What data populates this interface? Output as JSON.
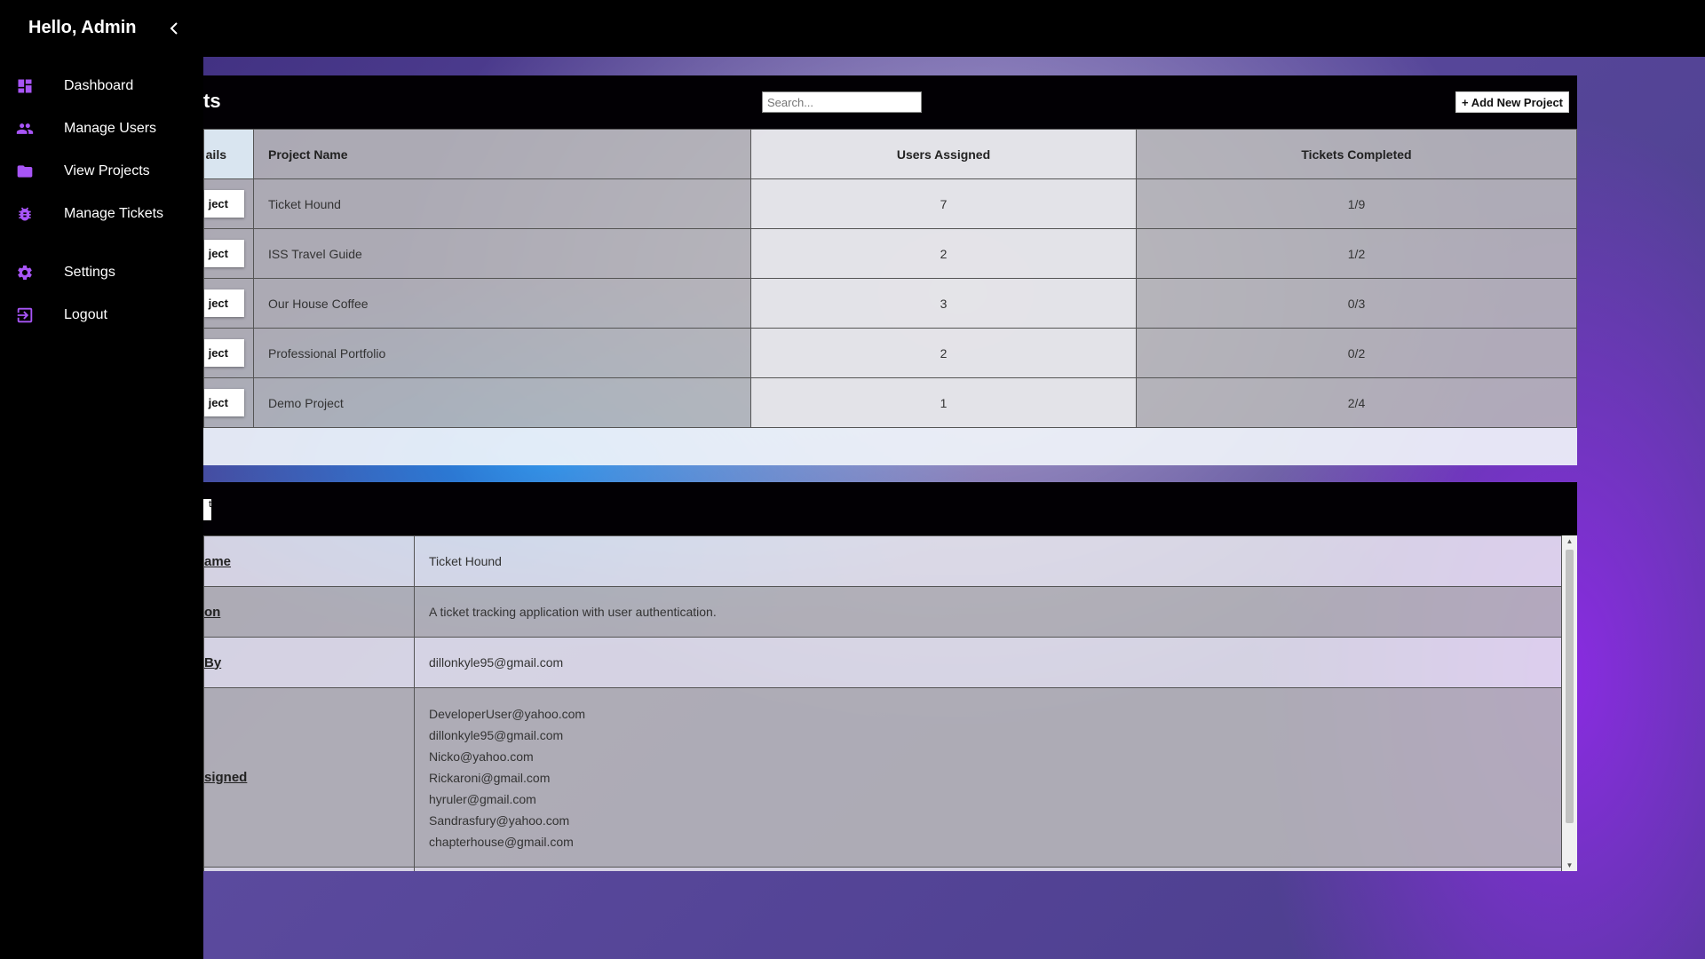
{
  "sidebar": {
    "greeting": "Hello, Admin",
    "items": [
      {
        "label": "Dashboard",
        "icon": "dashboard-icon"
      },
      {
        "label": "Manage Users",
        "icon": "users-icon"
      },
      {
        "label": "View Projects",
        "icon": "folder-icon"
      },
      {
        "label": "Manage Tickets",
        "icon": "bug-icon"
      },
      {
        "label": "Settings",
        "icon": "gear-icon"
      },
      {
        "label": "Logout",
        "icon": "logout-icon"
      }
    ]
  },
  "projects": {
    "title_visible": "ts",
    "search_placeholder": "Search...",
    "add_button": "+ Add New Project",
    "columns": [
      "ails",
      "Project Name",
      "Users Assigned",
      "Tickets Completed"
    ],
    "row_button": "ject",
    "rows": [
      {
        "name": "Ticket Hound",
        "users": "7",
        "tickets": "1/9"
      },
      {
        "name": "ISS Travel Guide",
        "users": "2",
        "tickets": "1/2"
      },
      {
        "name": "Our House Coffee",
        "users": "3",
        "tickets": "0/3"
      },
      {
        "name": "Professional Portfolio",
        "users": "2",
        "tickets": "0/2"
      },
      {
        "name": "Demo Project",
        "users": "1",
        "tickets": "2/4"
      }
    ]
  },
  "details": {
    "head_button": "t",
    "rows": [
      {
        "key": "ame",
        "value": "Ticket Hound"
      },
      {
        "key": "on",
        "value": "A ticket tracking application with user authentication."
      },
      {
        "key": "By",
        "value": "dillonkyle95@gmail.com"
      },
      {
        "key": "signed",
        "emails": [
          "DeveloperUser@yahoo.com",
          "dillonkyle95@gmail.com",
          "Nicko@yahoo.com",
          "Rickaroni@gmail.com",
          "hyruler@gmail.com",
          "Sandrasfury@yahoo.com",
          "chapterhouse@gmail.com"
        ]
      }
    ]
  },
  "colors": {
    "accent": "#a855f7",
    "sidebar_bg": "#000000"
  }
}
